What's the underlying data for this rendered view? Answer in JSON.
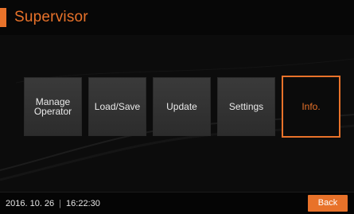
{
  "header": {
    "title": "Supervisor"
  },
  "menu": {
    "items": [
      {
        "label": "Manage\nOperator",
        "selected": false
      },
      {
        "label": "Load/Save",
        "selected": false
      },
      {
        "label": "Update",
        "selected": false
      },
      {
        "label": "Settings",
        "selected": false
      },
      {
        "label": "Info.",
        "selected": true
      }
    ]
  },
  "footer": {
    "date": "2016. 10. 26",
    "separator": "|",
    "time": "16:22:30",
    "back_label": "Back"
  },
  "colors": {
    "accent": "#e8722a",
    "background": "#0c0c0c",
    "tile": "#333333"
  }
}
